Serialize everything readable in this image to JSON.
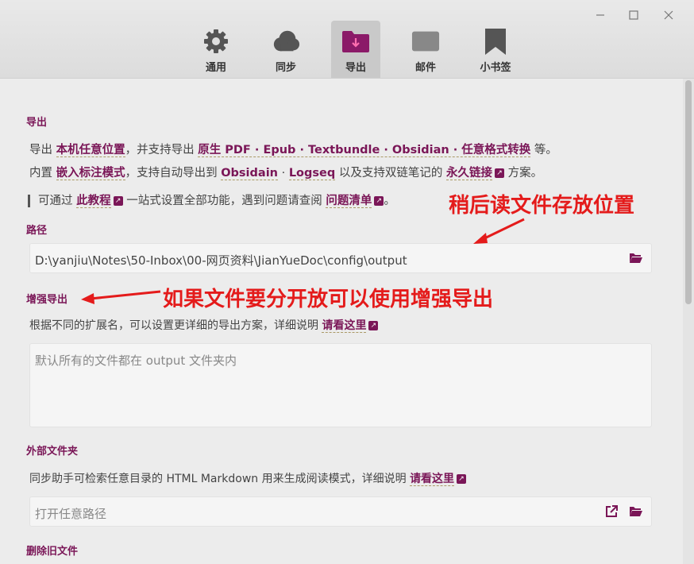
{
  "tabs": [
    {
      "label": "通用",
      "icon": "gear-icon"
    },
    {
      "label": "同步",
      "icon": "cloud-icon"
    },
    {
      "label": "导出",
      "icon": "folder-export-icon"
    },
    {
      "label": "邮件",
      "icon": "mail-icon"
    },
    {
      "label": "小书签",
      "icon": "bookmark-icon"
    }
  ],
  "export": {
    "heading": "导出",
    "line1": {
      "t1": "导出 ",
      "l1": "本机任意位置",
      "t2": "，并支持导出 ",
      "l2": "原生 PDF · Epub · Textbundle · Obsidian · 任意格式转换",
      "t3": " 等。"
    },
    "line2": {
      "t1": "内置 ",
      "l1": "嵌入标注模式",
      "t2": "，支持自动导出到 ",
      "l2": "Obsidain",
      "t3": " · ",
      "l3": "Logseq",
      "t4": " 以及支持双链笔记的 ",
      "l4": "永久链接",
      "t5": " 方案。"
    },
    "line3": {
      "t1": "可通过 ",
      "l1": "此教程",
      "t2": " 一站式设置全部功能，遇到问题请查阅 ",
      "l2": "问题清单",
      "t3": "。"
    }
  },
  "path": {
    "heading": "路径",
    "value": "D:\\yanjiu\\Notes\\50-Inbox\\00-网页资料\\JianYueDoc\\config\\output"
  },
  "enhanced": {
    "heading": "增强导出",
    "desc": "根据不同的扩展名，可以设置更详细的导出方案，详细说明 ",
    "link": "请看这里",
    "placeholder": "默认所有的文件都在 output 文件夹内"
  },
  "external": {
    "heading": "外部文件夹",
    "desc": "同步助手可检索任意目录的 HTML Markdown 用来生成阅读模式，详细说明 ",
    "link": "请看这里",
    "placeholder": "打开任意路径"
  },
  "delete": {
    "heading": "删除旧文件"
  },
  "annotations": {
    "a1": "稍后读文件存放位置",
    "a2": "如果文件要分开放可以使用增强导出"
  },
  "colors": {
    "accent": "#7a1657",
    "annotation": "#e41b1b"
  }
}
